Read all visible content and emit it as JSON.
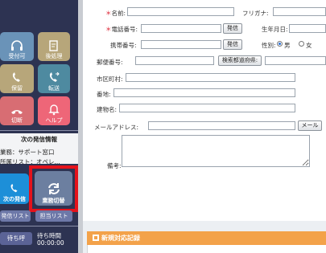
{
  "sidebar": {
    "tiles": [
      {
        "label": "受付可",
        "icon": "headset-icon"
      },
      {
        "label": "後処理",
        "icon": "document-edit-icon"
      },
      {
        "label": "保留",
        "icon": "phone-hold-icon"
      },
      {
        "label": "転送",
        "icon": "phone-transfer-icon"
      },
      {
        "label": "切断",
        "icon": "hangup-icon"
      },
      {
        "label": "ヘルプ",
        "icon": "bell-icon"
      }
    ],
    "next_call": {
      "heading": "次の発信情報",
      "line1": "業務：サポート窓口",
      "line2": "所属リスト：オペレ..."
    },
    "next_call_button": "次の発信",
    "switch_button": "業務切替",
    "call_list_button": "発信リスト",
    "assigned_list_button": "担当リスト",
    "wait_button": "待ち呼",
    "wait_time_label": "待ち時間",
    "wait_time_value": "00:00:00",
    "highlight_color": "#e5121b"
  },
  "form": {
    "name_label": "名前:",
    "furigana_label": "フリガナ:",
    "phone_label": "電話番号:",
    "call_button": "発信",
    "birthday_label": "生年月日:",
    "mobile_label": "携帯番号:",
    "mobile_call_button": "発信",
    "gender_label": "性別:",
    "gender_male": "男",
    "gender_female": "女",
    "postal_label": "郵便番号:",
    "prefecture_search_button": "検索都道府県:",
    "city_label": "市区町村:",
    "address_label": "番地:",
    "building_label": "建物名:",
    "email_label": "メールアドレス:",
    "mail_button": "メール",
    "notes_label": "備考:"
  },
  "records": {
    "title": "新規対応記録"
  }
}
